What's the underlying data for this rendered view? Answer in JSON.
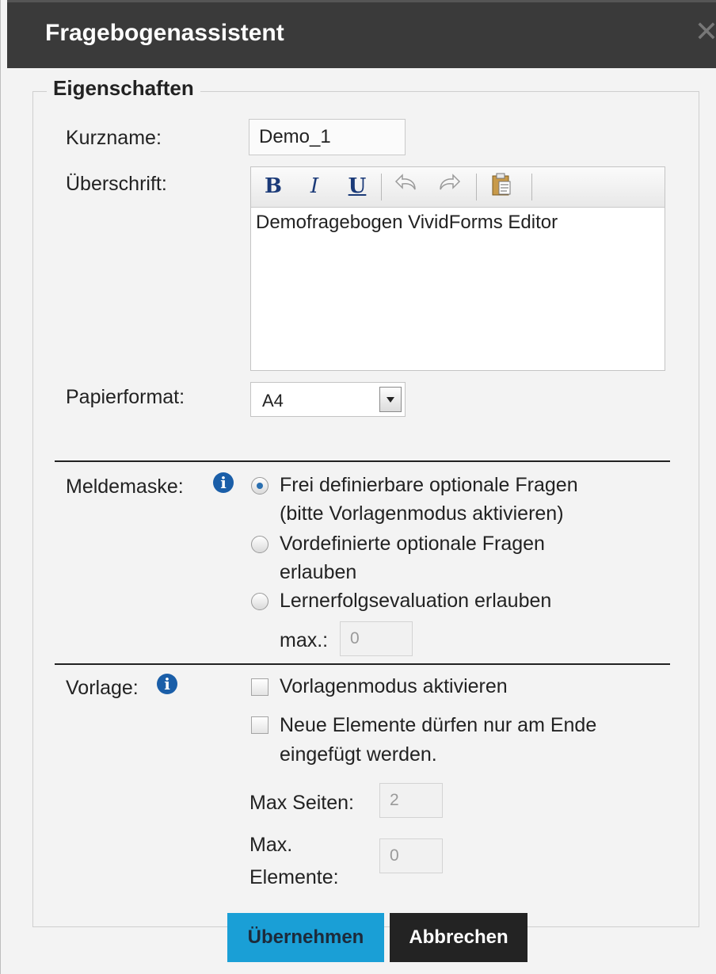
{
  "dialog": {
    "title": "Fragebogenassistent",
    "close_glyph": "✕"
  },
  "fieldset": {
    "legend": "Eigenschaften"
  },
  "kurzname": {
    "label": "Kurzname:",
    "value": "Demo_1"
  },
  "ueberschrift": {
    "label": "Überschrift:",
    "content": "Demofragebogen VividForms Editor",
    "toolbar": {
      "bold": "B",
      "italic": "I",
      "underline": "U",
      "undo_icon": "undo-icon",
      "redo_icon": "redo-icon",
      "paste_icon": "paste-icon"
    }
  },
  "papierformat": {
    "label": "Papierformat:",
    "selected": "A4"
  },
  "meldemaske": {
    "label": "Meldemaske:",
    "options": [
      {
        "line1": "Frei definierbare optionale Fragen",
        "line2": "(bitte Vorlagenmodus aktivieren)",
        "checked": true
      },
      {
        "line1": "Vordefinierte optionale Fragen",
        "line2": "erlauben",
        "checked": false
      },
      {
        "line1": "Lernerfolgsevaluation erlauben",
        "checked": false
      }
    ],
    "max_label": "max.:",
    "max_value": "0"
  },
  "vorlage": {
    "label": "Vorlage:",
    "checkbox1": "Vorlagenmodus aktivieren",
    "checkbox2_line1": "Neue Elemente dürfen nur am Ende",
    "checkbox2_line2": "eingefügt werden.",
    "max_seiten_label": "Max Seiten:",
    "max_seiten_value": "2",
    "max_elemente_label_line1": "Max.",
    "max_elemente_label_line2": "Elemente:",
    "max_elemente_value": "0"
  },
  "buttons": {
    "apply": "Übernehmen",
    "cancel": "Abbrechen"
  },
  "colors": {
    "titlebar": "#3a3a3a",
    "primary_button": "#1a9fd6",
    "secondary_button": "#232323",
    "info_icon": "#1a5ea8"
  }
}
